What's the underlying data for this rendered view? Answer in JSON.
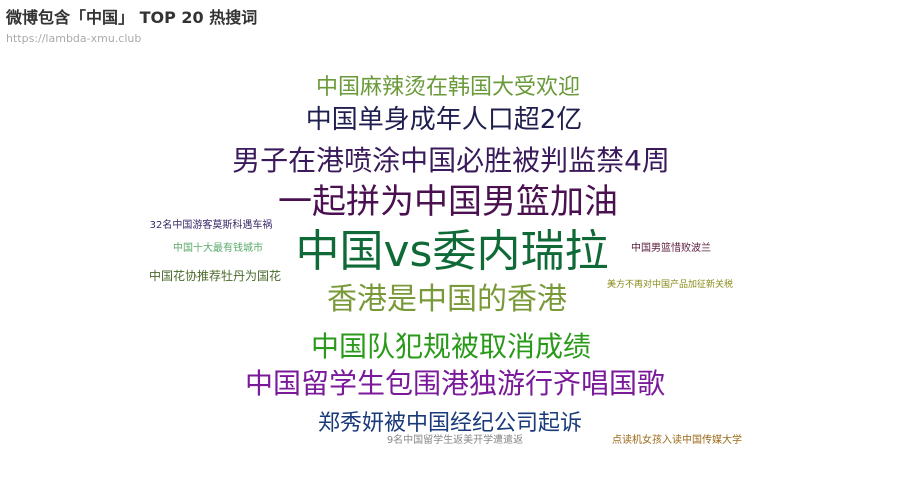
{
  "title": "微博包含「中国」 TOP 20 热搜词",
  "subtitle": "https://lambda-xmu.club",
  "chart_data": {
    "type": "wordcloud",
    "words": [
      {
        "text": "中国麻辣烫在韩国大受欢迎",
        "color": "#6a9a3a",
        "weight": 5
      },
      {
        "text": "中国单身成年人口超2亿",
        "color": "#1f1f4f",
        "weight": 6
      },
      {
        "text": "男子在港喷涂中国必胜被判监禁4周",
        "color": "#3a1a5a",
        "weight": 7
      },
      {
        "text": "一起拼为中国男篮加油",
        "color": "#4a1050",
        "weight": 8
      },
      {
        "text": "32名中国游客莫斯科遇车祸",
        "color": "#3a2a6a",
        "weight": 1
      },
      {
        "text": "中国十大最有钱城市",
        "color": "#5aaa6a",
        "weight": 1
      },
      {
        "text": "中国vs委内瑞拉",
        "color": "#106a38",
        "weight": 10
      },
      {
        "text": "中国男篮惜败波兰",
        "color": "#5a1a3a",
        "weight": 1
      },
      {
        "text": "中国花协推荐牡丹为国花",
        "color": "#4a6a2a",
        "weight": 2
      },
      {
        "text": "香港是中国的香港",
        "color": "#7a9a3a",
        "weight": 8
      },
      {
        "text": "美方不再对中国产品加征新关税",
        "color": "#8a8a1a",
        "weight": 1
      },
      {
        "text": "中国队犯规被取消成绩",
        "color": "#2a9a1a",
        "weight": 7
      },
      {
        "text": "中国留学生包围港独游行齐唱国歌",
        "color": "#7a1a9a",
        "weight": 7
      },
      {
        "text": "郑秀妍被中国经纪公司起诉",
        "color": "#1a3a7a",
        "weight": 5
      },
      {
        "text": "9名中国留学生返美开学遭遣返",
        "color": "#888888",
        "weight": 1
      },
      {
        "text": "点读机女孩入读中国传媒大学",
        "color": "#9a6a1a",
        "weight": 1
      }
    ]
  }
}
